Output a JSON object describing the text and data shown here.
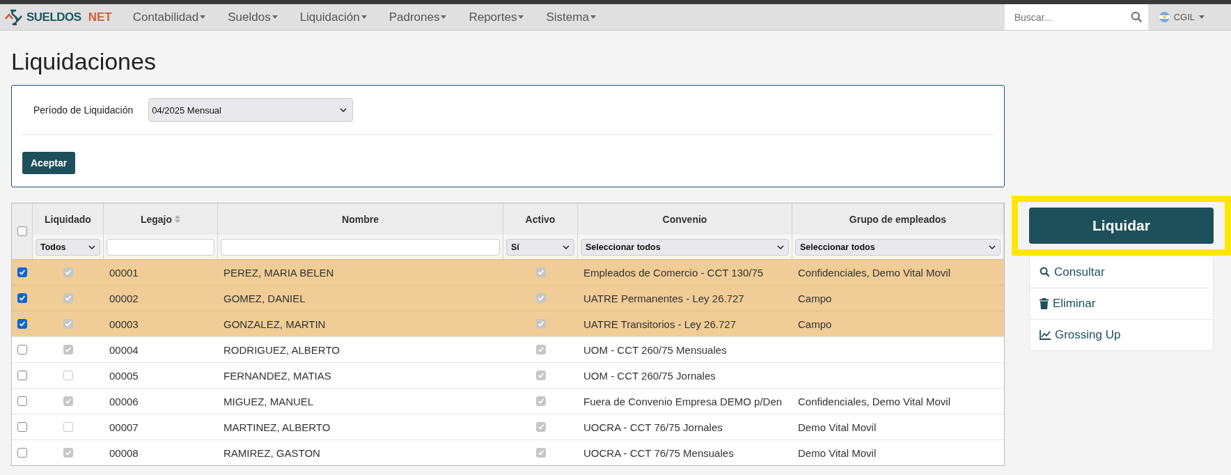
{
  "navbar": {
    "brand": {
      "first": "SUELDOS",
      "second": "NET"
    },
    "menus": [
      {
        "label": "Contabilidad"
      },
      {
        "label": "Sueldos"
      },
      {
        "label": "Liquidación"
      },
      {
        "label": "Padrones"
      },
      {
        "label": "Reportes"
      },
      {
        "label": "Sistema"
      }
    ],
    "search": {
      "placeholder": "Buscar..."
    },
    "user": {
      "label": "CGIL"
    }
  },
  "page_title": "Liquidaciones",
  "filter_panel": {
    "label": "Período de Liquidación",
    "value": "04/2025 Mensual",
    "button": "Aceptar"
  },
  "table": {
    "select_all": {
      "checked": false
    },
    "columns": [
      {
        "label": "Liquidado",
        "sortable": false,
        "filter": {
          "kind": "select",
          "value": "Todos"
        }
      },
      {
        "label": "Legajo",
        "sortable": true,
        "filter": {
          "kind": "input"
        }
      },
      {
        "label": "Nombre",
        "sortable": false,
        "filter": {
          "kind": "input"
        }
      },
      {
        "label": "Activo",
        "sortable": false,
        "filter": {
          "kind": "select",
          "value": "Sí"
        }
      },
      {
        "label": "Convenio",
        "sortable": false,
        "filter": {
          "kind": "select",
          "value": "Seleccionar todos"
        }
      },
      {
        "label": "Grupo de empleados",
        "sortable": false,
        "filter": {
          "kind": "select",
          "value": "Seleccionar todos"
        }
      }
    ],
    "rows": [
      {
        "selected": true,
        "liquidado": true,
        "legajo": "00001",
        "nombre": "PEREZ, MARIA BELEN",
        "activo": true,
        "convenio": "Empleados de Comercio - CCT 130/75",
        "grupo": "Confidenciales, Demo Vital Movil"
      },
      {
        "selected": true,
        "liquidado": true,
        "legajo": "00002",
        "nombre": "GOMEZ, DANIEL",
        "activo": true,
        "convenio": "UATRE Permanentes - Ley 26.727",
        "grupo": "Campo"
      },
      {
        "selected": true,
        "liquidado": true,
        "legajo": "00003",
        "nombre": "GONZALEZ, MARTIN",
        "activo": true,
        "convenio": "UATRE Transitorios - Ley 26.727",
        "grupo": "Campo"
      },
      {
        "selected": false,
        "liquidado": true,
        "legajo": "00004",
        "nombre": "RODRIGUEZ, ALBERTO",
        "activo": true,
        "convenio": "UOM - CCT 260/75 Mensuales",
        "grupo": ""
      },
      {
        "selected": false,
        "liquidado": false,
        "legajo": "00005",
        "nombre": "FERNANDEZ, MATIAS",
        "activo": true,
        "convenio": "UOM - CCT 260/75 Jornales",
        "grupo": ""
      },
      {
        "selected": false,
        "liquidado": true,
        "legajo": "00006",
        "nombre": "MIGUEZ, MANUEL",
        "activo": true,
        "convenio": "Fuera de Convenio Empresa DEMO p/Den",
        "grupo": "Confidenciales, Demo Vital Movil"
      },
      {
        "selected": false,
        "liquidado": false,
        "legajo": "00007",
        "nombre": "MARTINEZ, ALBERTO",
        "activo": true,
        "convenio": "UOCRA - CCT 76/75 Jornales",
        "grupo": "Demo Vital Movil"
      },
      {
        "selected": false,
        "liquidado": true,
        "legajo": "00008",
        "nombre": "RAMIREZ, GASTON",
        "activo": true,
        "convenio": "UOCRA - CCT 76/75 Mensuales",
        "grupo": "Demo Vital Movil"
      }
    ]
  },
  "actions": {
    "primary": {
      "label": "Liquidar",
      "highlighted": true
    },
    "links": [
      {
        "kind": "search",
        "label": "Consultar"
      },
      {
        "kind": "trash",
        "label": "Eliminar"
      },
      {
        "kind": "chart",
        "label": "Grossing Up"
      }
    ]
  }
}
